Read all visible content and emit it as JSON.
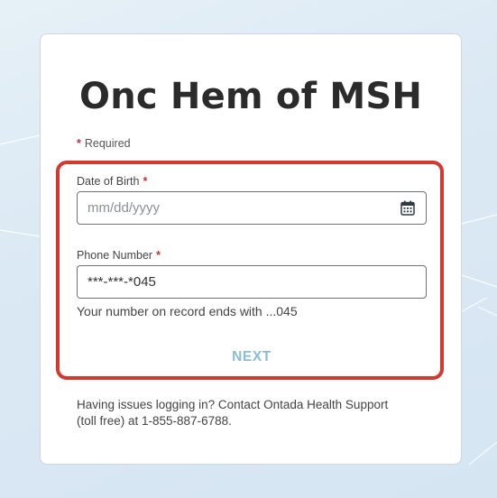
{
  "app": {
    "title": "Onc Hem of MSH"
  },
  "form": {
    "required_mark": "*",
    "required_note": "Required",
    "fields": {
      "dob": {
        "label": "Date of Birth",
        "required_mark": "*",
        "placeholder": "mm/dd/yyyy",
        "value": "",
        "icon": "calendar-icon"
      },
      "phone": {
        "label": "Phone Number",
        "required_mark": "*",
        "placeholder": "",
        "value": "***-***-*045"
      }
    },
    "hint": "Your number on record ends with ...045",
    "next_label": "NEXT"
  },
  "support": {
    "line1": "Having issues logging in? Contact Ontada Health Support",
    "line2": "(toll free) at 1-855-887-6788."
  },
  "colors": {
    "required": "#c9302c",
    "highlight_border": "#d3392f",
    "next_button_text": "#8bbcd7",
    "title_text": "#2b2b2b",
    "background": "#dbe9f4"
  }
}
